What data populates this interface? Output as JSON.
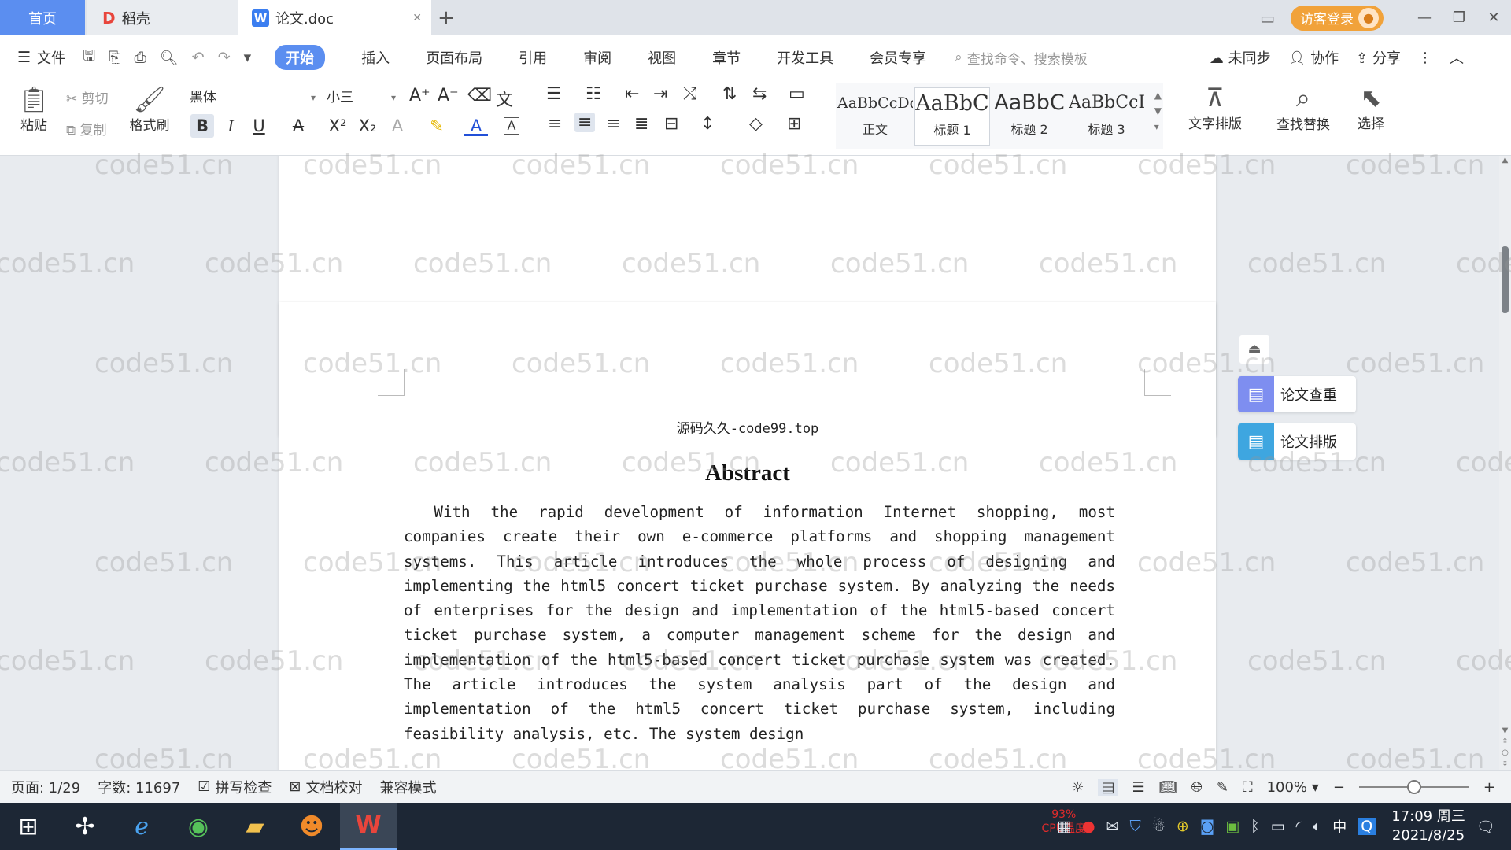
{
  "tabs": {
    "home": "首页",
    "daoke": "稻壳",
    "doc": "论文.doc",
    "new_tab": "+"
  },
  "titlebar": {
    "visitor_login": "访客登录"
  },
  "menu": {
    "file": "文件",
    "items": [
      "开始",
      "插入",
      "页面布局",
      "引用",
      "审阅",
      "视图",
      "章节",
      "开发工具",
      "会员专享"
    ],
    "search_placeholder": "查找命令、搜索模板",
    "unsynced": "未同步",
    "collaborate": "协作",
    "share": "分享"
  },
  "ribbon": {
    "paste": "粘贴",
    "cut": "剪切",
    "copy": "复制",
    "format_painter": "格式刷",
    "font_name": "黑体",
    "font_size": "小三",
    "styles": [
      {
        "sample": "AaBbCcDd",
        "name": "正文"
      },
      {
        "sample": "AaBbC",
        "name": "标题 1"
      },
      {
        "sample": "AaBbC",
        "name": "标题 2"
      },
      {
        "sample": "AaBbCcI",
        "name": "标题 3"
      }
    ],
    "text_layout": "文字排版",
    "find_replace": "查找替换",
    "select": "选择"
  },
  "document": {
    "header_text": "源码久久-code99.top",
    "abstract_title": "Abstract",
    "abstract_body": "With the rapid development of information Internet shopping, most companies create their own e-commerce platforms and shopping management systems. This article introduces the whole process of designing and implementing the html5 concert ticket purchase system. By analyzing the needs of enterprises for the design and implementation of the html5-based concert ticket purchase system, a computer management scheme for the design and implementation of the html5-based concert ticket purchase system was created. The article introduces the system analysis part of the design and implementation of the html5 concert ticket purchase system, including feasibility analysis, etc. The system design",
    "watermark": "code51.cn"
  },
  "side_panel": {
    "check": "论文查重",
    "layout": "论文排版"
  },
  "statusbar": {
    "page": "页面: 1/29",
    "word_count": "字数: 11697",
    "spell_check": "拼写检查",
    "proofread": "文档校对",
    "compat_mode": "兼容模式",
    "zoom": "100%",
    "zoom_level": 0.5
  },
  "taskbar": {
    "cpu_pct": "93%",
    "cpu_label": "CPU温度",
    "ime": "中",
    "time": "17:09 周三",
    "date": "2021/8/25"
  },
  "colors": {
    "accent": "#5b8ef0",
    "visitor": "#f1a23a",
    "taskbar": "#1d2735"
  }
}
